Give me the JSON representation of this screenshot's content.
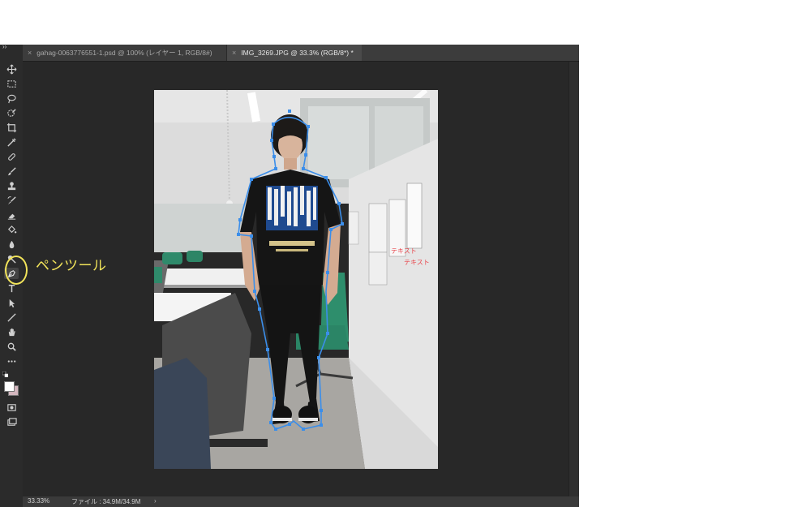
{
  "tabs": [
    {
      "label": "gahag-0063776551-1.psd @ 100% (レイヤー 1, RGB/8#)",
      "close": "×",
      "active": false
    },
    {
      "label": "IMG_3269.JPG @ 33.3% (RGB/8*) *",
      "close": "×",
      "active": true
    }
  ],
  "toolbar": {
    "collapse": "››",
    "tools": [
      "move-icon",
      "marquee-icon",
      "lasso-icon",
      "quick-select-icon",
      "crop-icon",
      "eyedropper-icon",
      "healing-icon",
      "brush-icon",
      "stamp-icon",
      "history-brush-icon",
      "eraser-icon",
      "paint-bucket-icon",
      "blur-icon",
      "dodge-icon",
      "pen-icon",
      "type-icon",
      "path-select-icon",
      "line-icon",
      "hand-icon",
      "zoom-icon",
      "more-icon"
    ],
    "active_tool": "pen-icon",
    "foreground_color": "#ffffff",
    "background_color": "#d3b6be"
  },
  "photo": {
    "overlay_text_line1": "テキスト",
    "overlay_text_line2": "テキスト",
    "overlay_color": "#e8484e",
    "path_color": "#3b8eea"
  },
  "callout": {
    "label": "ペンツール",
    "color": "#f2e45a"
  },
  "status": {
    "zoom": "33.33%",
    "file": "ファイル : 34.9M/34.9M",
    "arrow": "›"
  }
}
